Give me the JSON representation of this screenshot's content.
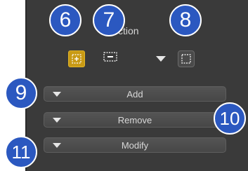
{
  "panel": {
    "section_title": "ction"
  },
  "toolbar": {
    "new_selection_icon": "square-plus-icon",
    "subtract_selection_icon": "square-minus-icon",
    "intersect_selection_icon": "square-dashed-icon",
    "dropdown_icon": "triangle-down-icon"
  },
  "rollouts": [
    {
      "label": "Add"
    },
    {
      "label": "Remove"
    },
    {
      "label": "Modify"
    }
  ],
  "callouts": [
    "6",
    "7",
    "8",
    "9",
    "10",
    "11"
  ],
  "colors": {
    "panel_bg": "#3a3a3a",
    "accent_active": "#c99a14",
    "callout_blue": "#2b58c0",
    "text": "#d8d8d8"
  }
}
